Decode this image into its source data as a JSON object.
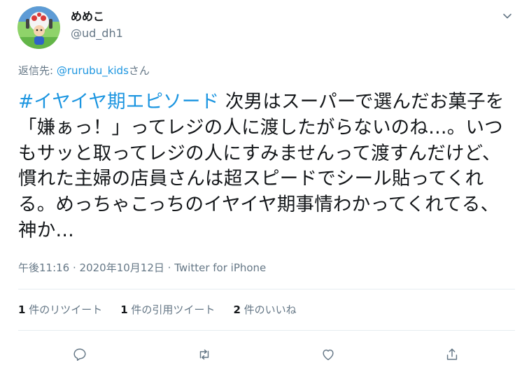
{
  "author": {
    "display_name": "めめこ",
    "handle": "@ud_dh1"
  },
  "reply_to": {
    "prefix": "返信先: ",
    "mention": "@rurubu_kids",
    "suffix": "さん"
  },
  "tweet": {
    "hashtag": "#イヤイヤ期エピソード",
    "text": " 次男はスーパーで選んだお菓子を「嫌ぁっ！」ってレジの人に渡したがらないのね…。いつもサッと取ってレジの人にすみませんって渡すんだけど、慣れた主婦の店員さんは超スピードでシール貼ってくれる。めっちゃこっちのイヤイヤ期事情わかってくれてる、神か…"
  },
  "meta": {
    "time": "午後11:16",
    "separator1": " · ",
    "date": "2020年10月12日",
    "separator2": " · ",
    "source": "Twitter for iPhone"
  },
  "stats": {
    "retweets_count": "1",
    "retweets_label": " 件のリツイート",
    "quotes_count": "1",
    "quotes_label": " 件の引用ツイート",
    "likes_count": "2",
    "likes_label": " 件のいいね"
  },
  "icons": {
    "reply": "reply-icon",
    "retweet": "retweet-icon",
    "like": "heart-icon",
    "share": "share-icon",
    "menu": "chevron-down-icon"
  },
  "colors": {
    "link": "#1b95e0",
    "text": "#14171a",
    "secondary": "#657786",
    "divider": "#e6ecf0"
  }
}
